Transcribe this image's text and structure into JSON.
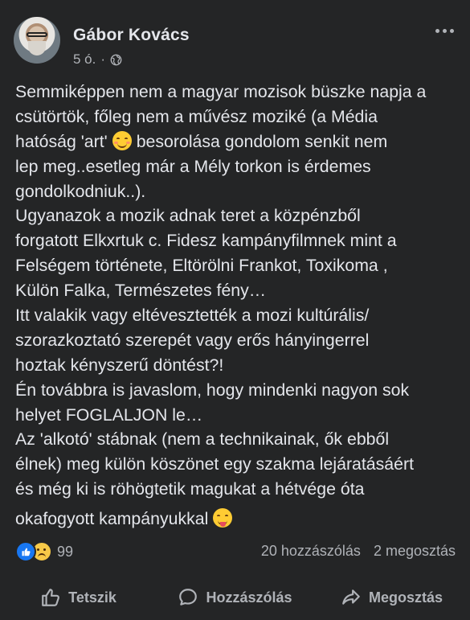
{
  "post": {
    "author": "Gábor Kovács",
    "time": "5 ó.",
    "separator": "·",
    "privacy_icon": "globe-icon",
    "more_icon": "more-options-icon",
    "body_lines": [
      "Semmiképpen nem a magyar mozisok büszke napja a",
      "csütörtök, főleg nem a művész moziké (a Média",
      {
        "before": "hatóság 'art'",
        "emoji": "smiling-face-emoji",
        "after": "besorolása gondolom senkit nem"
      },
      "lep meg..esetleg már a Mély torkon is érdemes",
      "gondolkodniuk..).",
      "Ugyanazok a mozik  adnak teret  a közpénzből",
      "forgatott Elkxrtuk c. Fidesz kampányfilmnek mint a",
      "Felségem története, Eltörölni Frankot, Toxikoma ,",
      "Külön Falka, Természetes fény…",
      "Itt valakik vagy eltévesztették a mozi kultúrális/",
      "szorazkoztató szerepét vagy erős hányingerrel",
      "hoztak kényszerű döntést?!",
      "Én továbbra is javaslom, hogy mindenki nagyon sok",
      "helyet FOGLALJON le…",
      "Az 'alkotó' stábnak (nem a technikainak, ők ebből",
      "élnek) meg külön köszönet egy szakma lejáratásáért",
      "és még ki is röhögtetik magukat a hétvége óta",
      {
        "before": "okafogyott kampányukkal",
        "emoji": "tongue-out-emoji",
        "after": ""
      }
    ]
  },
  "stats": {
    "reaction_icons": [
      "like-reaction-icon",
      "sad-reaction-icon"
    ],
    "reaction_count": "99",
    "comments": "20 hozzászólás",
    "shares": "2 megosztás"
  },
  "actions": {
    "like": "Tetszik",
    "comment": "Hozzászólás",
    "share": "Megosztás"
  },
  "colors": {
    "background": "#242526",
    "text": "#e4e6eb",
    "secondary": "#b0b3b8",
    "like_blue": "#1877f2"
  }
}
